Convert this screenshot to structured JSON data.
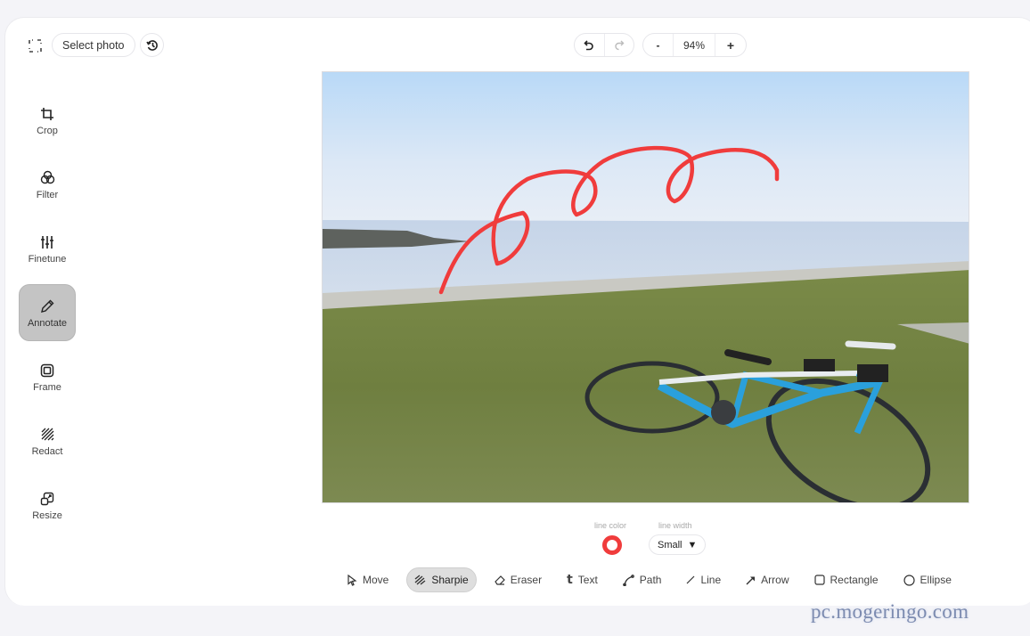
{
  "header": {
    "fullscreen_icon": "fullscreen-corners-icon",
    "select_photo_label": "Select photo",
    "history_icon": "history-clock-icon",
    "undo_icon": "undo-icon",
    "redo_icon": "redo-icon",
    "zoom_out_label": "-",
    "zoom_level": "94%",
    "zoom_in_label": "+"
  },
  "sidebar": {
    "items": [
      {
        "label": "Crop",
        "icon": "crop-icon",
        "active": false
      },
      {
        "label": "Filter",
        "icon": "filter-circles-icon",
        "active": false
      },
      {
        "label": "Finetune",
        "icon": "sliders-icon",
        "active": false
      },
      {
        "label": "Annotate",
        "icon": "pencil-icon",
        "active": true
      },
      {
        "label": "Frame",
        "icon": "frame-icon",
        "active": false
      },
      {
        "label": "Redact",
        "icon": "redact-hatch-icon",
        "active": false
      },
      {
        "label": "Resize",
        "icon": "resize-icon",
        "active": false
      }
    ]
  },
  "canvas": {
    "image_description": "Blue road bicycle lying on grass by the seaside under a pale blue sky",
    "annotation_color": "#f03c3c"
  },
  "options": {
    "line_color_label": "line color",
    "line_color": "#f03c3c",
    "line_width_label": "line width",
    "line_width_value": "Small",
    "line_width_caret": "▼"
  },
  "tools": [
    {
      "label": "Move",
      "icon": "cursor-arrow-icon",
      "active": false
    },
    {
      "label": "Sharpie",
      "icon": "sharpie-icon",
      "active": true
    },
    {
      "label": "Eraser",
      "icon": "eraser-icon",
      "active": false
    },
    {
      "label": "Text",
      "icon": "text-t-icon",
      "active": false
    },
    {
      "label": "Path",
      "icon": "path-icon",
      "active": false
    },
    {
      "label": "Line",
      "icon": "line-icon",
      "active": false
    },
    {
      "label": "Arrow",
      "icon": "arrow-icon",
      "active": false
    },
    {
      "label": "Rectangle",
      "icon": "rectangle-icon",
      "active": false
    },
    {
      "label": "Ellipse",
      "icon": "ellipse-icon",
      "active": false
    }
  ],
  "watermark": "pc.mogeringo.com"
}
